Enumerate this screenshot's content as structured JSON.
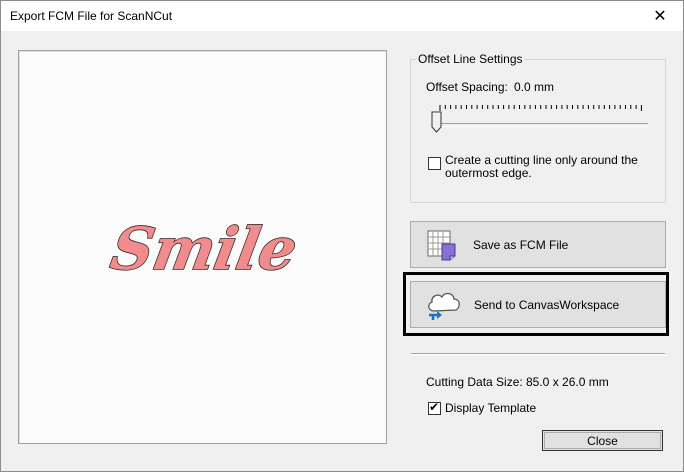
{
  "window": {
    "title": "Export FCM File for ScanNCut",
    "close_glyph": "✕"
  },
  "preview": {
    "text": "Smile",
    "fill_color": "#f08c8e",
    "stroke_color": "#3a2a2a"
  },
  "offset_settings": {
    "group_label": "Offset Line Settings",
    "spacing_label": "Offset Spacing:",
    "spacing_value": "0.0 mm",
    "slider_value": 0,
    "outer_edge_checkbox": {
      "label_line1": "Create a cutting line only around the",
      "label_line2": "outermost edge.",
      "checked": false
    }
  },
  "buttons": {
    "save_fcm": {
      "label": "Save as FCM File",
      "icon": "fcm-file-icon"
    },
    "send_canvas": {
      "label": "Send to CanvasWorkspace",
      "icon": "cloud-upload-icon"
    },
    "close": {
      "label": "Close"
    }
  },
  "info": {
    "cutting_size_label": "Cutting Data Size:",
    "cutting_size_value": "85.0 x 26.0 mm",
    "display_template": {
      "label": "Display Template",
      "checked": true
    }
  }
}
